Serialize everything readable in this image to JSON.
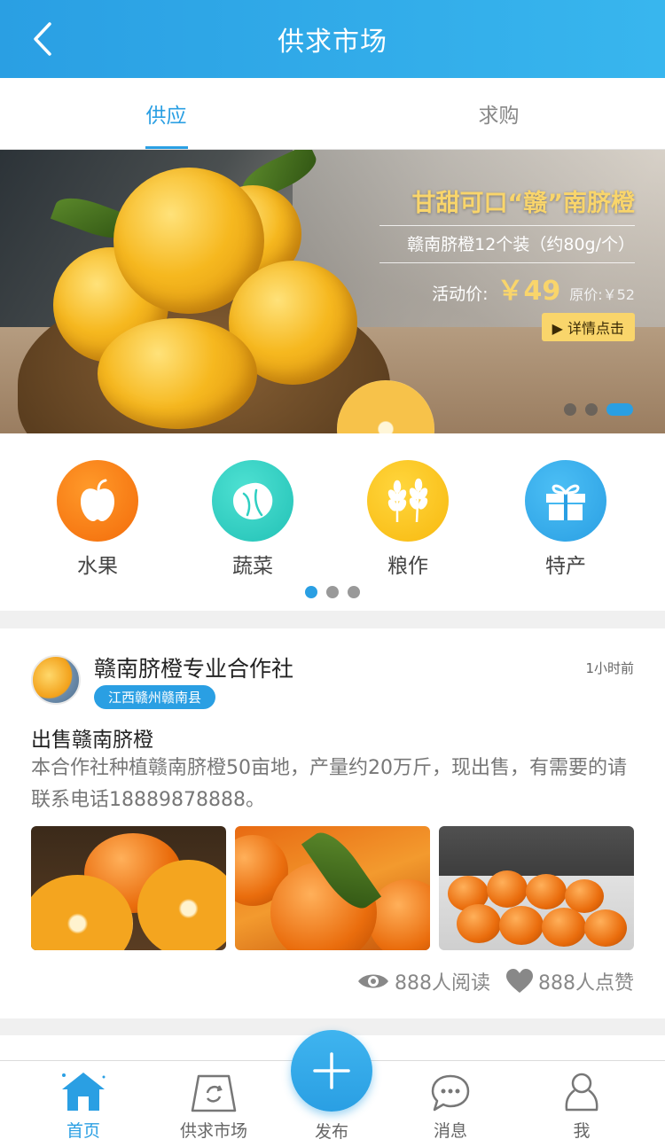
{
  "header": {
    "title": "供求市场"
  },
  "tabs": [
    {
      "label": "供应",
      "active": true
    },
    {
      "label": "求购",
      "active": false
    }
  ],
  "banner": {
    "headline": "甘甜可口“赣”南脐橙",
    "subtitle": "赣南脐橙12个装（约80g/个）",
    "price_label": "活动价:",
    "price": "￥49",
    "original_price": "原价:￥52",
    "detail_button": "▶ 详情点击",
    "slides": 3,
    "active_slide": 3
  },
  "categories": [
    {
      "label": "水果",
      "icon": "apple-icon",
      "color": "#f97f16"
    },
    {
      "label": "蔬菜",
      "icon": "cabbage-icon",
      "color": "#2fcfc2"
    },
    {
      "label": "粮作",
      "icon": "wheat-icon",
      "color": "#fbc51c"
    },
    {
      "label": "特产",
      "icon": "gift-icon",
      "color": "#2a9fe3"
    }
  ],
  "category_pages": 3,
  "category_active_page": 1,
  "post": {
    "author": "赣南脐橙专业合作社",
    "location": "江西赣州赣南县",
    "time": "1小时前",
    "title": "出售赣南脐橙",
    "body": "本合作社种植赣南脐橙50亩地，产量约20万斤，现出售，有需要的请联系电话18889878888。",
    "photos": [
      "sliced-oranges-photo",
      "oranges-with-leaf-photo",
      "oranges-in-crate-photo"
    ],
    "reads": "888人阅读",
    "likes": "888人点赞"
  },
  "tabbar": {
    "items": [
      {
        "label": "首页",
        "icon": "home-icon",
        "active": true
      },
      {
        "label": "供求市场",
        "icon": "market-bag-icon",
        "active": false
      },
      {
        "label": "发布",
        "icon": "plus-icon",
        "active": false
      },
      {
        "label": "消息",
        "icon": "chat-bubble-icon",
        "active": false
      },
      {
        "label": "我",
        "icon": "person-icon",
        "active": false
      }
    ]
  },
  "colors": {
    "primary": "#2a9fe3",
    "banner_accent": "#f9d56b"
  }
}
